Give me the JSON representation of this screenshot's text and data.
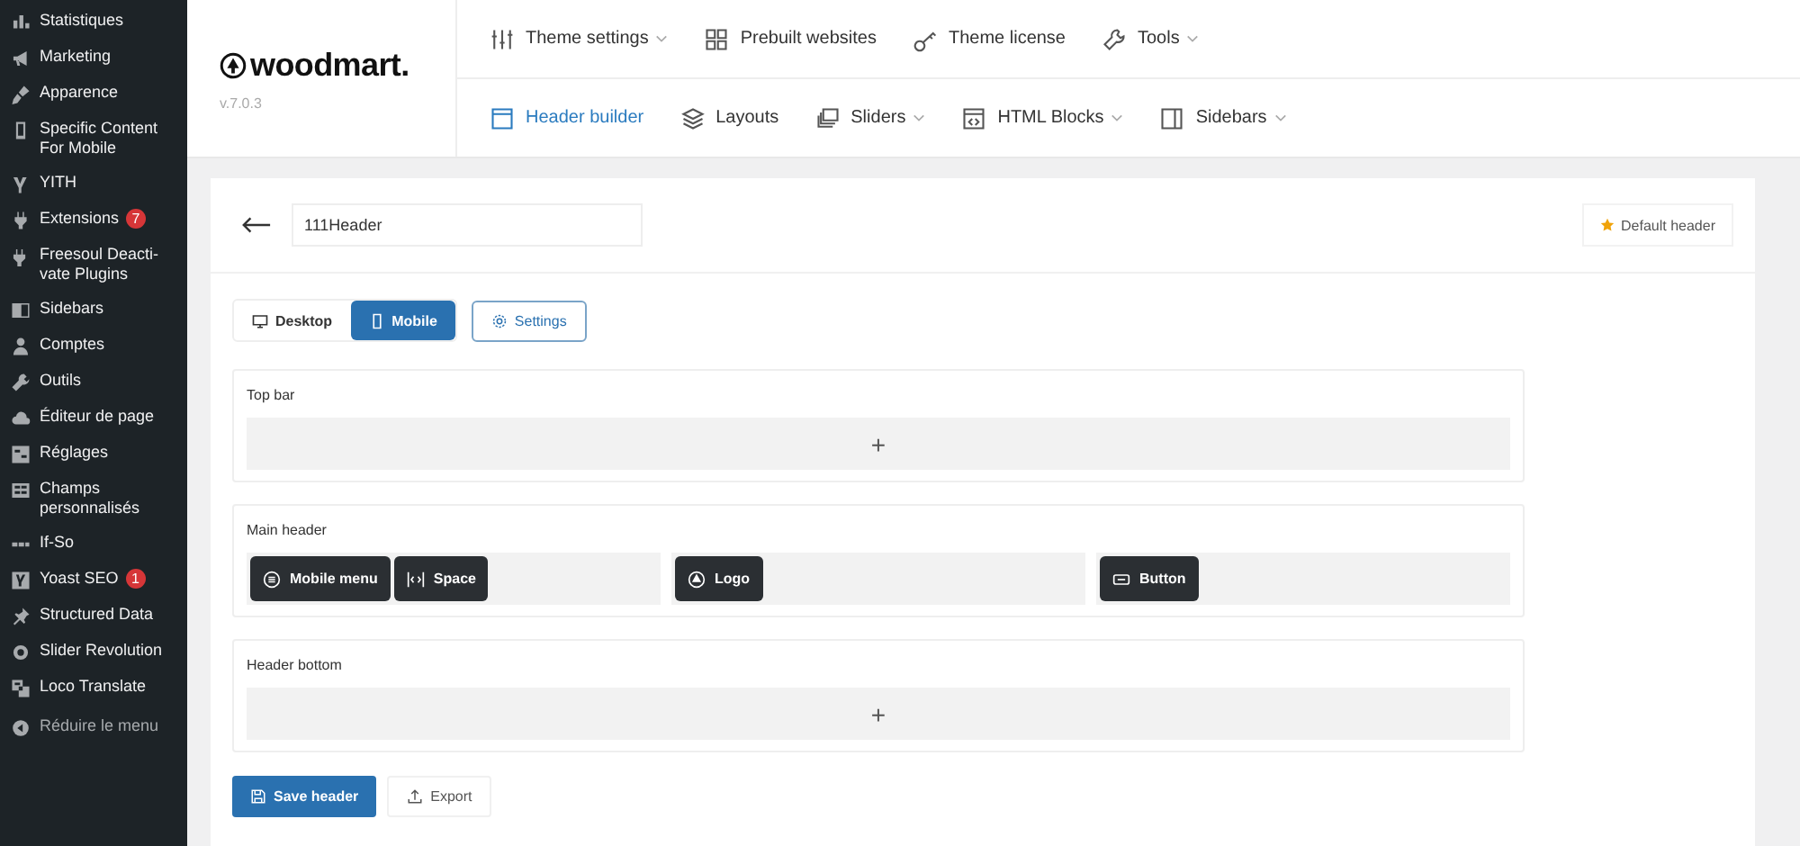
{
  "sidebar": {
    "items": [
      {
        "label": "Statistiques"
      },
      {
        "label": "Marketing"
      },
      {
        "label": "Apparence"
      },
      {
        "label": "Specific Content For Mobile"
      },
      {
        "label": "YITH"
      },
      {
        "label": "Extensions",
        "badge": "7"
      },
      {
        "label": "Freesoul Deacti-vate Plugins"
      },
      {
        "label": "Sidebars"
      },
      {
        "label": "Comptes"
      },
      {
        "label": "Outils"
      },
      {
        "label": "Éditeur de page"
      },
      {
        "label": "Réglages"
      },
      {
        "label": "Champs personnalisés"
      },
      {
        "label": "If-So"
      },
      {
        "label": "Yoast SEO",
        "badge": "1"
      },
      {
        "label": "Structured Data"
      },
      {
        "label": "Slider Revolution"
      },
      {
        "label": "Loco Translate"
      }
    ],
    "collapse": "Réduire le menu"
  },
  "brand": {
    "name": "woodmart.",
    "version": "v.7.0.3"
  },
  "nav_top": [
    {
      "label": "Theme settings",
      "dropdown": true
    },
    {
      "label": "Prebuilt websites",
      "dropdown": false
    },
    {
      "label": "Theme license",
      "dropdown": false
    },
    {
      "label": "Tools",
      "dropdown": true
    }
  ],
  "nav_bottom": [
    {
      "label": "Header builder",
      "dropdown": false,
      "selected": true
    },
    {
      "label": "Layouts",
      "dropdown": false,
      "selected": false
    },
    {
      "label": "Sliders",
      "dropdown": true,
      "selected": false
    },
    {
      "label": "HTML Blocks",
      "dropdown": true,
      "selected": false
    },
    {
      "label": "Sidebars",
      "dropdown": true,
      "selected": false
    }
  ],
  "header_name": {
    "value": "111Header"
  },
  "default_button": "Default header",
  "device_tabs": [
    {
      "label": "Desktop",
      "selected": false
    },
    {
      "label": "Mobile",
      "selected": true
    }
  ],
  "settings_button": "Settings",
  "rows": [
    {
      "title": "Top bar",
      "kind": "empty",
      "add": "+"
    },
    {
      "title": "Main header",
      "kind": "columns",
      "columns": [
        [
          {
            "label": "Mobile menu",
            "kind": "menu"
          },
          {
            "label": "Space",
            "kind": "space"
          }
        ],
        [
          {
            "label": "Logo",
            "kind": "logo"
          }
        ],
        [
          {
            "label": "Button",
            "kind": "button"
          }
        ]
      ]
    },
    {
      "title": "Header bottom",
      "kind": "empty",
      "add": "+"
    }
  ],
  "actions": [
    {
      "label": "Save header",
      "kind": "primary"
    },
    {
      "label": "Export",
      "kind": "secondary"
    }
  ]
}
